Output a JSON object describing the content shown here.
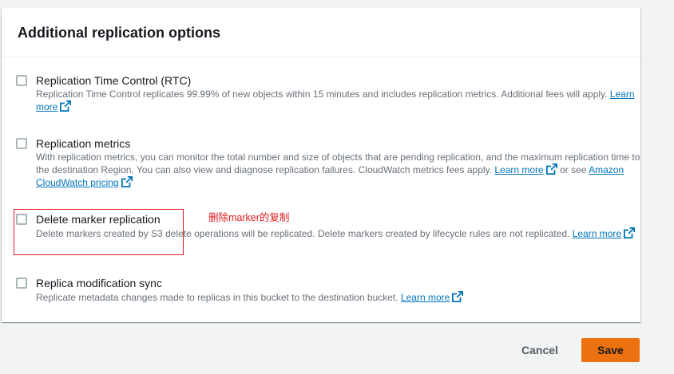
{
  "panel": {
    "title": "Additional replication options"
  },
  "options": [
    {
      "label": "Replication Time Control (RTC)",
      "desc": "Replication Time Control replicates 99.99% of new objects within 15 minutes and includes replication metrics. Additional fees will apply.",
      "link": "Learn more",
      "checked": false
    },
    {
      "label": "Replication metrics",
      "desc": "With replication metrics, you can monitor the total number and size of objects that are pending replication, and the maximum replication time to the destination Region. You can also view and diagnose replication failures. CloudWatch metrics fees apply.",
      "link": "Learn more",
      "connector": "or see",
      "link2": "Amazon CloudWatch pricing",
      "checked": false
    },
    {
      "label": "Delete marker replication",
      "desc": "Delete markers created by S3 delete operations will be replicated. Delete markers created by lifecycle rules are not replicated.",
      "link": "Learn more",
      "checked": false
    },
    {
      "label": "Replica modification sync",
      "desc": "Replicate metadata changes made to replicas in this bucket to the destination bucket.",
      "link": "Learn more",
      "checked": false
    }
  ],
  "annotation": {
    "text": "删除marker的复制",
    "color": "#e0191b"
  },
  "footer": {
    "cancel_label": "Cancel",
    "save_label": "Save"
  },
  "colors": {
    "link": "#0073bb",
    "primary_button": "#ec7211",
    "checkbox_border": "#aab7b8"
  },
  "icons": {
    "external_link": "external-link-icon"
  }
}
